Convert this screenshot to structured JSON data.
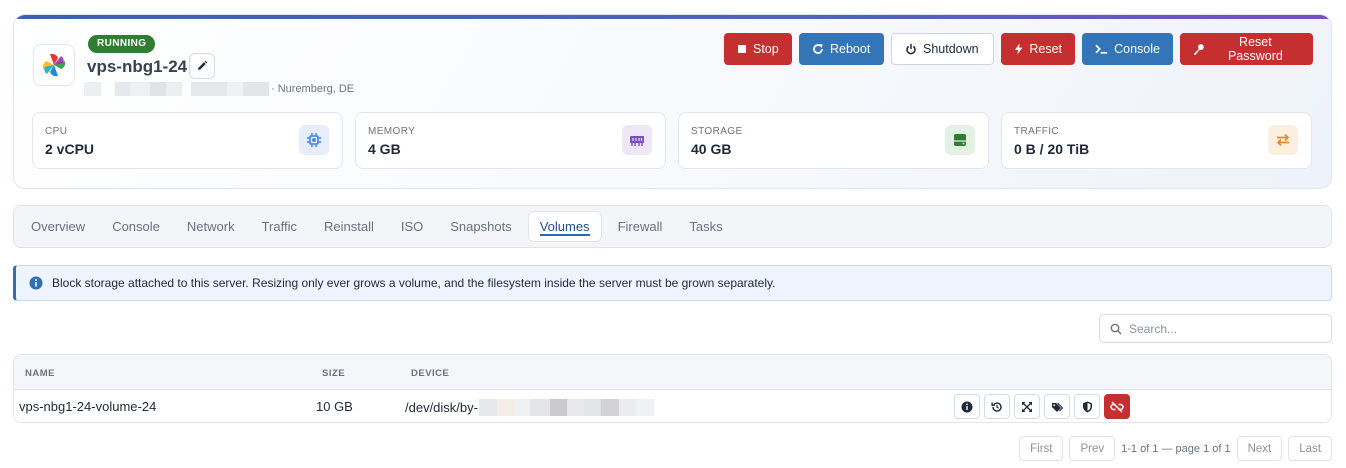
{
  "server": {
    "status": "RUNNING",
    "name": "vps-nbg1-24",
    "location": "· Nuremberg, DE"
  },
  "actions": [
    {
      "label": "Stop",
      "icon": "stop-icon"
    },
    {
      "label": "Reboot",
      "icon": "reboot-icon"
    },
    {
      "label": "Shutdown",
      "icon": "power-icon"
    },
    {
      "label": "Reset",
      "icon": "bolt-icon"
    },
    {
      "label": "Console",
      "icon": "terminal-icon"
    },
    {
      "label": "Reset Password",
      "icon": "key-icon"
    }
  ],
  "stats": [
    {
      "label": "CPU",
      "value": "2 vCPU",
      "icon": "cpu-icon",
      "color": "#3b7dd8"
    },
    {
      "label": "MEMORY",
      "value": "4 GB",
      "icon": "memory-icon",
      "color": "#7c4dbd"
    },
    {
      "label": "STORAGE",
      "value": "40 GB",
      "icon": "storage-icon",
      "color": "#2e7d32"
    },
    {
      "label": "TRAFFIC",
      "value": "0 B / 20 TiB",
      "icon": "transfer-icon",
      "color": "#e08a2c"
    }
  ],
  "tabs": [
    "Overview",
    "Console",
    "Network",
    "Traffic",
    "Reinstall",
    "ISO",
    "Snapshots",
    "Volumes",
    "Firewall",
    "Tasks"
  ],
  "active_tab": "Volumes",
  "info_text": "Block storage attached to this server. Resizing only ever grows a volume, and the filesystem inside the server must be grown separately.",
  "search": {
    "placeholder": "Search..."
  },
  "table": {
    "columns": [
      "NAME",
      "SIZE",
      "DEVICE"
    ],
    "rows": [
      {
        "name": "vps-nbg1-24-volume-24",
        "size": "10 GB",
        "device": "/dev/disk/by-"
      }
    ]
  },
  "pagination": {
    "first": "First",
    "prev": "Prev",
    "info": "1-1 of 1 — page 1 of 1",
    "next": "Next",
    "last": "Last"
  }
}
